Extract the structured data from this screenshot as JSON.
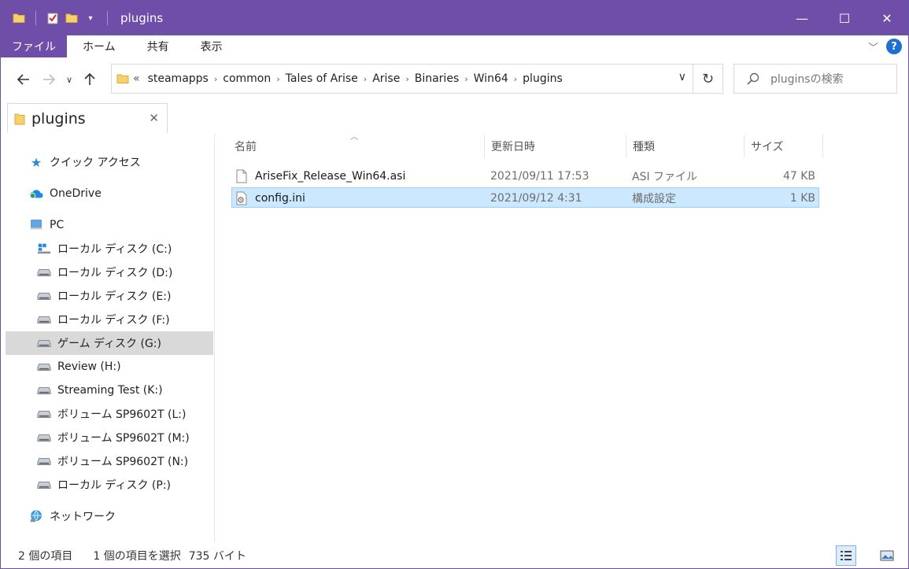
{
  "window": {
    "title": "plugins",
    "accent": "#6e4ea8",
    "controls": {
      "minimize": "—",
      "maximize": "☐",
      "close": "✕"
    }
  },
  "ribbon": {
    "tabs": [
      "ファイル",
      "ホーム",
      "共有",
      "表示"
    ]
  },
  "address": {
    "overflow": "«",
    "crumbs": [
      "steamapps",
      "common",
      "Tales of Arise",
      "Arise",
      "Binaries",
      "Win64",
      "plugins"
    ]
  },
  "search": {
    "placeholder": "pluginsの検索"
  },
  "pane_tab": {
    "label": "plugins"
  },
  "nav": {
    "quick_access": "クイック アクセス",
    "onedrive": "OneDrive",
    "pc": "PC",
    "drives": [
      "ローカル ディスク (C:)",
      "ローカル ディスク (D:)",
      "ローカル ディスク (E:)",
      "ローカル ディスク (F:)",
      "ゲーム ディスク (G:)",
      "Review (H:)",
      "Streaming Test (K:)",
      "ボリューム SP9602T (L:)",
      "ボリューム SP9602T (M:)",
      "ボリューム SP9602T (N:)",
      "ローカル ディスク (P:)"
    ],
    "network": "ネットワーク"
  },
  "columns": {
    "name": "名前",
    "date": "更新日時",
    "type": "種類",
    "size": "サイズ"
  },
  "files": [
    {
      "name": "AriseFix_Release_Win64.asi",
      "date": "2021/09/11 17:53",
      "type": "ASI ファイル",
      "size": "47 KB"
    },
    {
      "name": "config.ini",
      "date": "2021/09/12 4:31",
      "type": "構成設定",
      "size": "1 KB"
    }
  ],
  "status": {
    "count": "2 個の項目",
    "selection": "1 個の項目を選択",
    "size": "735 バイト"
  }
}
